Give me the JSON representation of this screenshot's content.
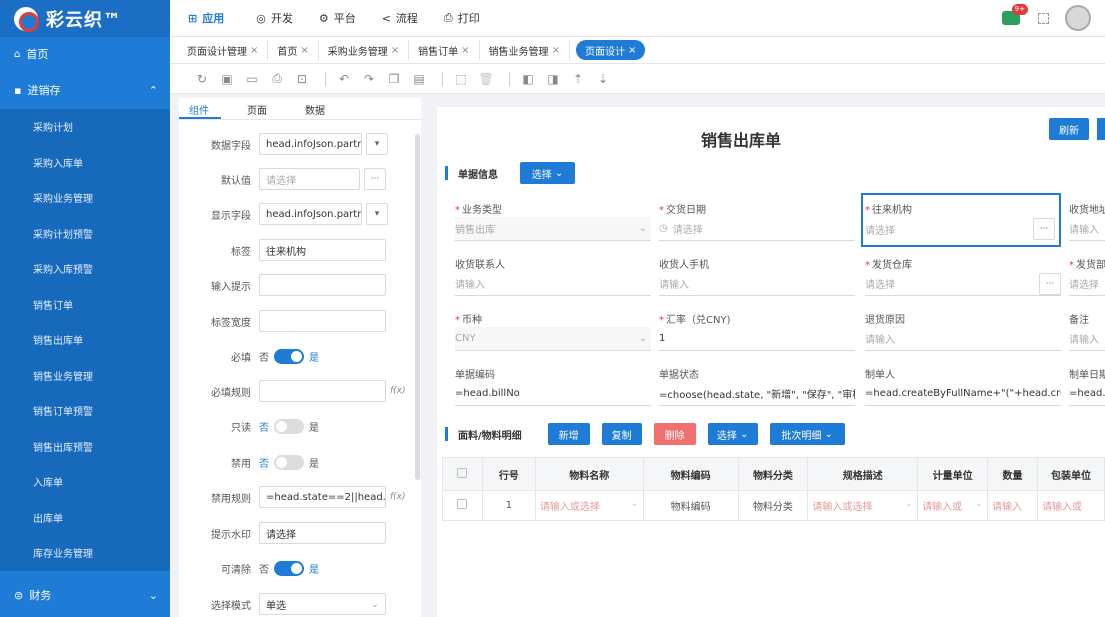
{
  "app": {
    "name": "彩云织™"
  },
  "sidebar": {
    "home": "首页",
    "group": "进销存",
    "items": [
      {
        "label": "采购计划"
      },
      {
        "label": "采购入库单"
      },
      {
        "label": "采购业务管理"
      },
      {
        "label": "采购计划预警"
      },
      {
        "label": "采购入库预警"
      },
      {
        "label": "销售订单"
      },
      {
        "label": "销售出库单"
      },
      {
        "label": "销售业务管理"
      },
      {
        "label": "销售订单预警"
      },
      {
        "label": "销售出库预警"
      },
      {
        "label": "入库单"
      },
      {
        "label": "出库单"
      },
      {
        "label": "库存业务管理"
      }
    ],
    "finance": "财务"
  },
  "topnav": {
    "items": [
      "应用",
      "开发",
      "平台",
      "流程",
      "打印"
    ],
    "badge": "9+"
  },
  "tabs": [
    {
      "label": "页面设计管理"
    },
    {
      "label": "首页"
    },
    {
      "label": "采购业务管理"
    },
    {
      "label": "销售订单"
    },
    {
      "label": "销售业务管理"
    },
    {
      "label": "页面设计"
    }
  ],
  "props": {
    "tabs": [
      "组件",
      "页面",
      "数据"
    ],
    "fields": {
      "data_field": {
        "label": "数据字段",
        "value": "head.infoJson.partner"
      },
      "default": {
        "label": "默认值",
        "placeholder": "请选择"
      },
      "display_field": {
        "label": "显示字段",
        "value": "head.infoJson.partner"
      },
      "title": {
        "label": "标签",
        "value": "往来机构"
      },
      "hint": {
        "label": "输入提示"
      },
      "label_width": {
        "label": "标签宽度"
      },
      "required": {
        "label": "必填",
        "no": "否",
        "yes": "是"
      },
      "required_rule": {
        "label": "必填规则",
        "fx": "f(x)"
      },
      "readonly": {
        "label": "只读",
        "no": "否",
        "yes": "是"
      },
      "disabled": {
        "label": "禁用",
        "no": "否",
        "yes": "是"
      },
      "disable_rule": {
        "label": "禁用规则",
        "value": "=head.state==2||head.sta",
        "fx": "f(x)"
      },
      "watermark": {
        "label": "提示水印",
        "value": "请选择"
      },
      "clearable": {
        "label": "可清除",
        "no": "否",
        "yes": "是"
      },
      "select_mode": {
        "label": "选择模式",
        "value": "单选"
      }
    }
  },
  "form": {
    "title": "销售出库单",
    "refresh": "刷新",
    "section1": {
      "title": "单据信息",
      "select_btn": "选择"
    },
    "fields": [
      {
        "label": "业务类型",
        "req": true,
        "value": "销售出库",
        "kind": "dis"
      },
      {
        "label": "交货日期",
        "req": true,
        "value": "请选择",
        "kind": "ph"
      },
      {
        "label": "往来机构",
        "req": true,
        "value": "请选择",
        "kind": "ph"
      },
      {
        "label": "收货地址",
        "req": false,
        "value": "请输入",
        "kind": "ph"
      },
      {
        "label": "收货联系人",
        "req": false,
        "value": "请输入",
        "kind": "ph"
      },
      {
        "label": "收货人手机",
        "req": false,
        "value": "请输入",
        "kind": "ph"
      },
      {
        "label": "发货仓库",
        "req": true,
        "value": "请选择",
        "kind": "ph"
      },
      {
        "label": "发货部门",
        "req": true,
        "value": "请选择",
        "kind": "ph"
      },
      {
        "label": "币种",
        "req": true,
        "value": "CNY",
        "kind": "dis"
      },
      {
        "label": "汇率（兑CNY)",
        "req": true,
        "value": "1",
        "kind": "val"
      },
      {
        "label": "退货原因",
        "req": false,
        "value": "请输入",
        "kind": "ph"
      },
      {
        "label": "备注",
        "req": false,
        "value": "请输入",
        "kind": "ph"
      },
      {
        "label": "单据编码",
        "req": false,
        "value": "=head.billNo",
        "kind": "val"
      },
      {
        "label": "单据状态",
        "req": false,
        "value": "=choose(head.state, \"新增\", \"保存\", \"审核...",
        "kind": "val"
      },
      {
        "label": "制单人",
        "req": false,
        "value": "=head.createByFullName+\"(\"+head.creat...",
        "kind": "val"
      },
      {
        "label": "制单日期",
        "req": false,
        "value": "=head.c",
        "kind": "val"
      }
    ],
    "section2": {
      "title": "面料/物料明细",
      "add": "新增",
      "copy": "复制",
      "delete": "删除",
      "select": "选择",
      "batch": "批次明细"
    },
    "table": {
      "headers": [
        "",
        "行号",
        "物料名称",
        "物料编码",
        "物料分类",
        "规格描述",
        "计量单位",
        "数量",
        "包装单位"
      ],
      "row": [
        "",
        "1",
        "请输入或选择",
        "物料编码",
        "物料分类",
        "请输入或选择",
        "请输入或",
        "请输入",
        "请输入或"
      ]
    }
  },
  "colors": {
    "accent": "#1e7bd6",
    "danger": "#f07070"
  }
}
